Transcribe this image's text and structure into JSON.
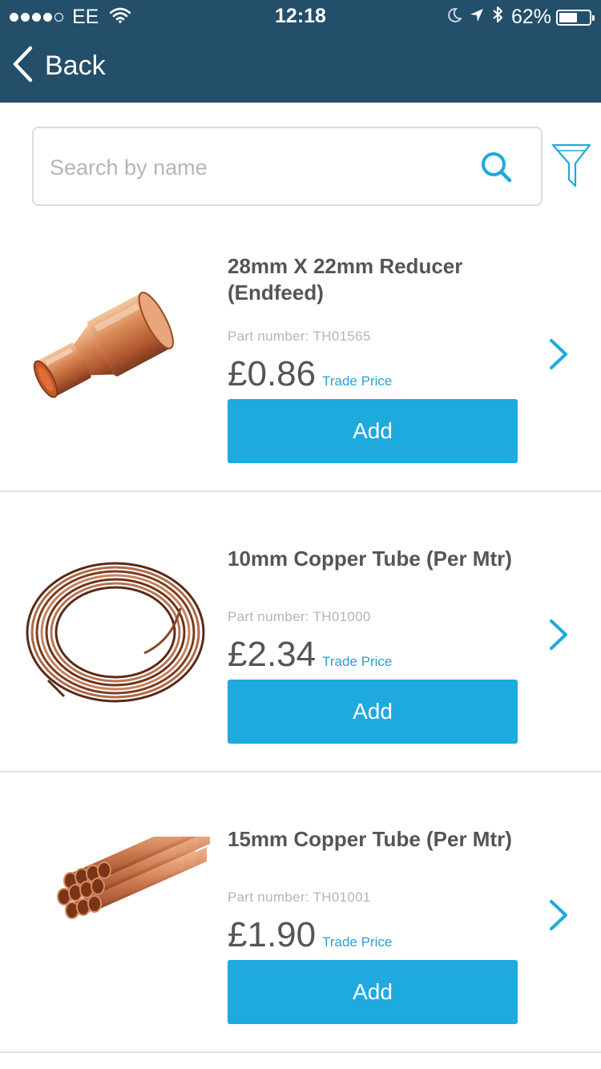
{
  "status_bar": {
    "carrier": "EE",
    "time": "12:18",
    "battery": "62%",
    "battery_level": 0.62
  },
  "nav": {
    "back_label": "Back"
  },
  "search": {
    "placeholder": "Search by name",
    "value": ""
  },
  "products": [
    {
      "title": "28mm X 22mm Reducer (Endfeed)",
      "part_number": "Part number: TH01565",
      "price": "£0.86",
      "price_note": "Trade Price",
      "add_label": "Add"
    },
    {
      "title": "10mm Copper Tube (Per Mtr)",
      "part_number": "Part number: TH01000",
      "price": "£2.34",
      "price_note": "Trade Price",
      "add_label": "Add"
    },
    {
      "title": "15mm Copper Tube (Per Mtr)",
      "part_number": "Part number: TH01001",
      "price": "£1.90",
      "price_note": "Trade Price",
      "add_label": "Add"
    }
  ],
  "colors": {
    "header": "#234f6a",
    "accent": "#1ea9df",
    "trade_price": "#2aa0d6",
    "copper": "#c8784a"
  },
  "icons": [
    "back-chevron-icon",
    "search-icon",
    "filter-icon",
    "chevron-right-icon",
    "wifi-icon",
    "moon-icon",
    "location-icon",
    "bluetooth-icon",
    "battery-icon"
  ]
}
